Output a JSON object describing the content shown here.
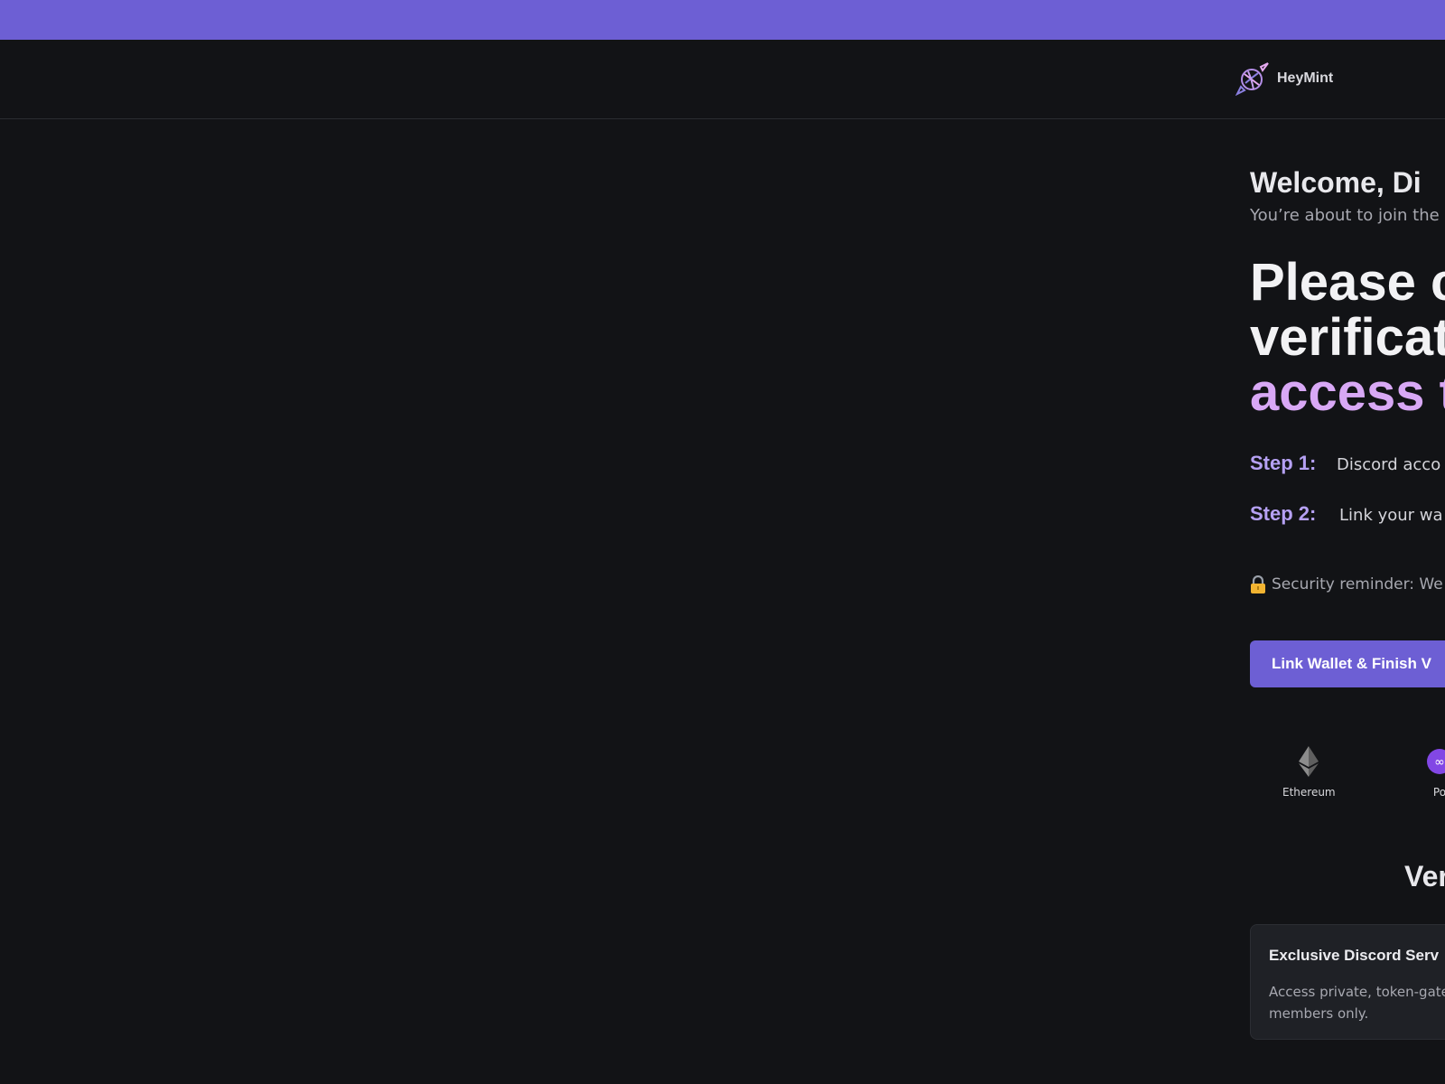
{
  "brand": {
    "name": "HeyMint",
    "logo_icon": "candy-icon",
    "accent": "#6d5fd4",
    "highlight": "#d8a8f5",
    "step_color": "#b6a1f4"
  },
  "welcome": {
    "title": "Welcome, Di",
    "subtitle": "You’re about to join the"
  },
  "headline": {
    "line1": "Please c",
    "line2": "verificat",
    "line3": "access t"
  },
  "steps": [
    {
      "label": "Step 1:",
      "text": "Discord acco"
    },
    {
      "label": "Step 2:",
      "text": "Link your wa"
    }
  ],
  "security": {
    "icon": "lock-icon",
    "text": "Security reminder: We"
  },
  "cta": {
    "label": "Link Wallet & Finish V"
  },
  "chains": [
    {
      "name": "Ethereum",
      "icon": "ethereum-icon"
    },
    {
      "name": "Po",
      "icon": "polygon-icon"
    }
  ],
  "section": {
    "title": "Ver"
  },
  "cards": [
    {
      "title": "Exclusive Discord Serv",
      "description": "Access private, token-gate verified members only."
    }
  ]
}
